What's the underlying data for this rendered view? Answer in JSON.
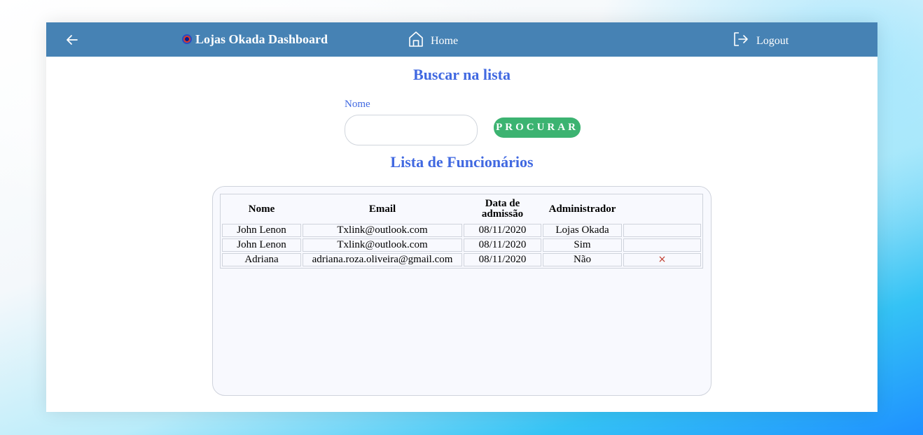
{
  "navbar": {
    "back_icon": "arrow-left-icon",
    "brand_title": "Lojas Okada Dashboard",
    "brand_logo": "okada-logo",
    "home_label": "Home",
    "home_icon": "home-icon",
    "logout_label": "Logout",
    "logout_icon": "logout-icon",
    "background_color": "#4682b4"
  },
  "search": {
    "title": "Buscar na lista",
    "name_label": "Nome",
    "name_value": "",
    "button_label": "PROCURAR",
    "button_color": "#3cb371"
  },
  "employees": {
    "title": "Lista de Funcionários",
    "columns": [
      "Nome",
      "Email",
      "Data de admissão",
      "Administrador",
      ""
    ],
    "rows": [
      {
        "nome": "John Lenon",
        "email": "Txlink@outlook.com",
        "data_admissao": "08/11/2020",
        "administrador": "Lojas Okada",
        "action": ""
      },
      {
        "nome": "John Lenon",
        "email": "Txlink@outlook.com",
        "data_admissao": "08/11/2020",
        "administrador": "Sim",
        "action": ""
      },
      {
        "nome": "Adriana",
        "email": "adriana.roza.oliveira@gmail.com",
        "data_admissao": "08/11/2020",
        "administrador": "Não",
        "action": "×"
      }
    ]
  },
  "theme": {
    "accent": "#4169e1",
    "delete_color": "#c0392b"
  }
}
